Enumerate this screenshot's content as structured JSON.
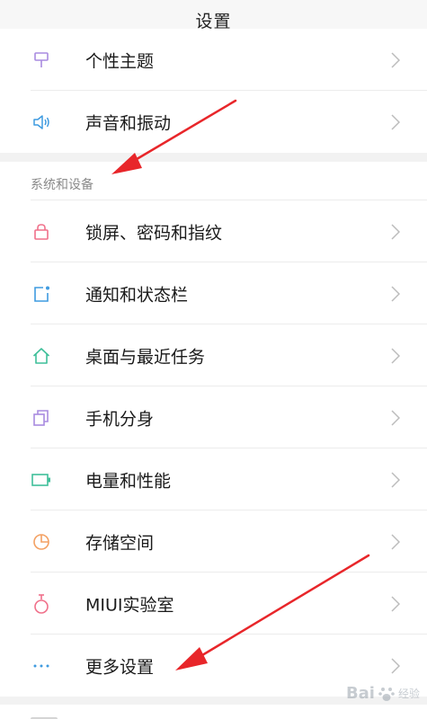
{
  "header": {
    "title": "设置"
  },
  "section_top": {
    "items": [
      {
        "label": "个性主题",
        "icon": "paint-brush-icon",
        "color": "#a98be0"
      },
      {
        "label": "声音和振动",
        "icon": "speaker-icon",
        "color": "#3f9be0"
      }
    ]
  },
  "section_system": {
    "title": "系统和设备",
    "items": [
      {
        "label": "锁屏、密码和指纹",
        "icon": "lock-icon",
        "color": "#f0708a"
      },
      {
        "label": "通知和状态栏",
        "icon": "notification-icon",
        "color": "#3f9be0"
      },
      {
        "label": "桌面与最近任务",
        "icon": "home-icon",
        "color": "#3fbf9a"
      },
      {
        "label": "手机分身",
        "icon": "dual-space-icon",
        "color": "#a98be0"
      },
      {
        "label": "电量和性能",
        "icon": "battery-icon",
        "color": "#3fbf9a"
      },
      {
        "label": "存储空间",
        "icon": "storage-pie-icon",
        "color": "#f3a062"
      },
      {
        "label": "MIUI实验室",
        "icon": "flask-icon",
        "color": "#f0708a"
      },
      {
        "label": "更多设置",
        "icon": "more-dots-icon",
        "color": "#3f9be0"
      }
    ]
  },
  "watermark": {
    "brand": "Bai",
    "sub": "经验"
  }
}
